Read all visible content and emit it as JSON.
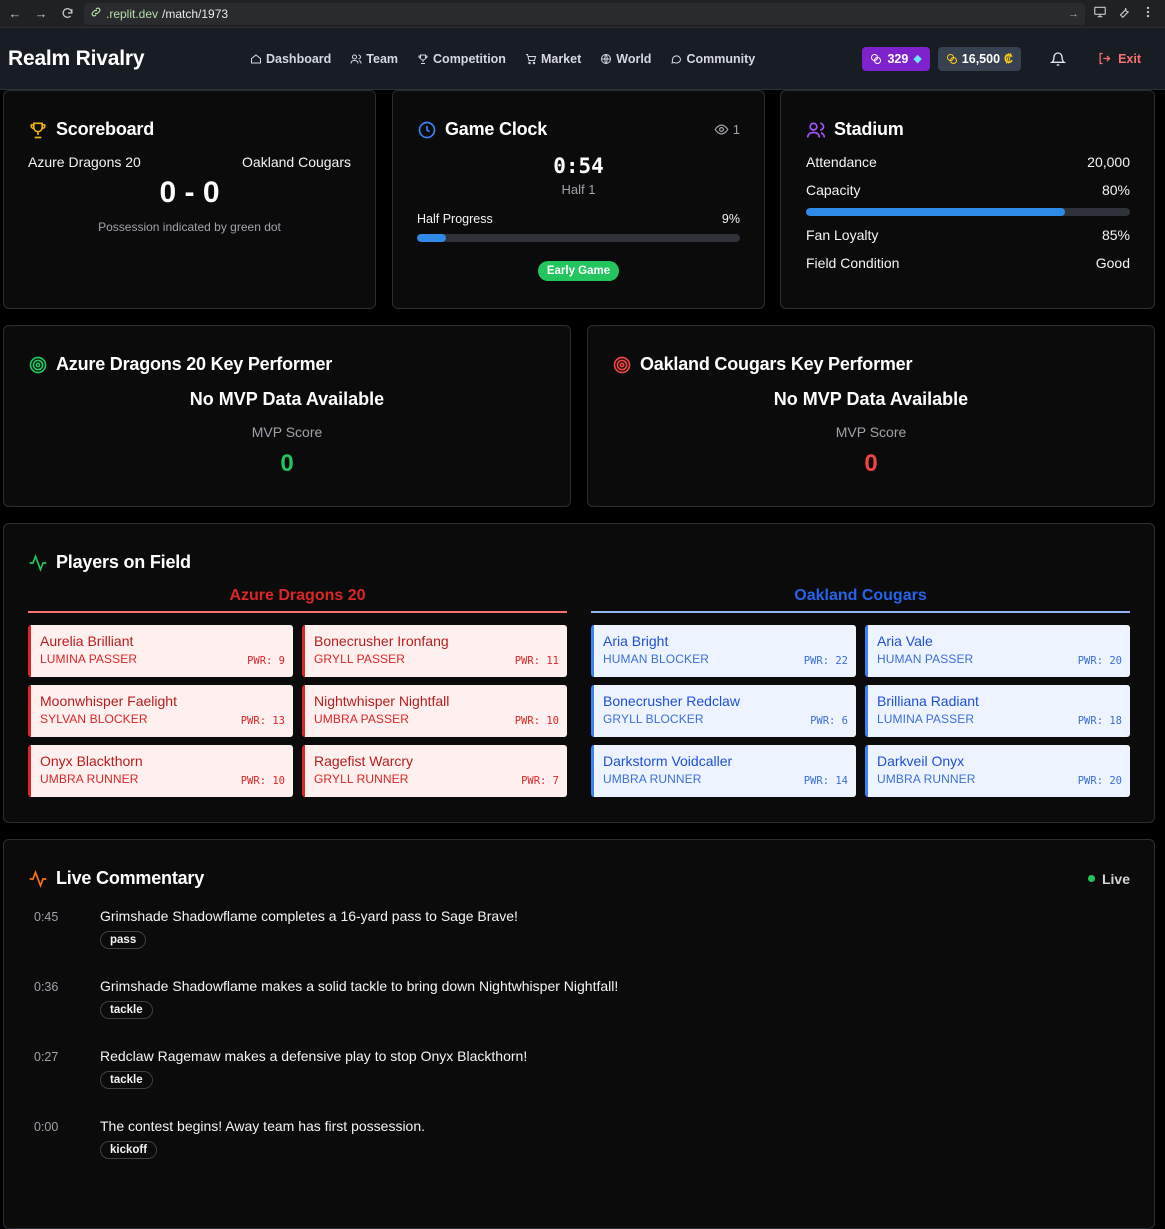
{
  "browser": {
    "url_domain": ".replit.dev",
    "url_path": "/match/1973"
  },
  "app": {
    "brand": "Realm Rivalry",
    "nav": [
      {
        "label": "Dashboard",
        "icon": "home-icon"
      },
      {
        "label": "Team",
        "icon": "users-icon"
      },
      {
        "label": "Competition",
        "icon": "trophy-icon"
      },
      {
        "label": "Market",
        "icon": "cart-icon"
      },
      {
        "label": "World",
        "icon": "globe-icon"
      },
      {
        "label": "Community",
        "icon": "chat-icon"
      }
    ],
    "gems": "329",
    "credits": "16,500",
    "credit_symbol": "₡",
    "exit_label": "Exit"
  },
  "scoreboard": {
    "title": "Scoreboard",
    "home_team": "Azure Dragons 20",
    "away_team": "Oakland Cougars",
    "score": "0 - 0",
    "note": "Possession indicated by green dot"
  },
  "game_clock": {
    "title": "Game Clock",
    "viewers": "1",
    "time": "0:54",
    "half": "Half 1",
    "progress_label": "Half Progress",
    "progress_text": "9%",
    "progress_fraction": 0.09,
    "phase_badge": "Early Game"
  },
  "stadium": {
    "title": "Stadium",
    "attendance_label": "Attendance",
    "attendance": "20,000",
    "capacity_label": "Capacity",
    "capacity": "80%",
    "capacity_fraction": 0.8,
    "loyalty_label": "Fan Loyalty",
    "loyalty": "85%",
    "field_label": "Field Condition",
    "field": "Good"
  },
  "key_performers": {
    "home": {
      "title": "Azure Dragons 20 Key Performer",
      "headline": "No MVP Data Available",
      "score_label": "MVP Score",
      "score": "0",
      "color": "#22c55e"
    },
    "away": {
      "title": "Oakland Cougars Key Performer",
      "headline": "No MVP Data Available",
      "score_label": "MVP Score",
      "score": "0",
      "color": "#ef4444"
    }
  },
  "players_on_field": {
    "title": "Players on Field",
    "home": {
      "team": "Azure Dragons 20",
      "players": [
        {
          "name": "Aurelia Brilliant",
          "role": "LUMINA PASSER",
          "pwr": "PWR: 9"
        },
        {
          "name": "Bonecrusher Ironfang",
          "role": "GRYLL PASSER",
          "pwr": "PWR: 11"
        },
        {
          "name": "Moonwhisper Faelight",
          "role": "SYLVAN BLOCKER",
          "pwr": "PWR: 13"
        },
        {
          "name": "Nightwhisper Nightfall",
          "role": "UMBRA PASSER",
          "pwr": "PWR: 10"
        },
        {
          "name": "Onyx Blackthorn",
          "role": "UMBRA RUNNER",
          "pwr": "PWR: 10"
        },
        {
          "name": "Ragefist Warcry",
          "role": "GRYLL RUNNER",
          "pwr": "PWR: 7"
        }
      ]
    },
    "away": {
      "team": "Oakland Cougars",
      "players": [
        {
          "name": "Aria Bright",
          "role": "HUMAN BLOCKER",
          "pwr": "PWR: 22"
        },
        {
          "name": "Aria Vale",
          "role": "HUMAN PASSER",
          "pwr": "PWR: 20"
        },
        {
          "name": "Bonecrusher Redclaw",
          "role": "GRYLL BLOCKER",
          "pwr": "PWR: 6"
        },
        {
          "name": "Brilliana Radiant",
          "role": "LUMINA PASSER",
          "pwr": "PWR: 18"
        },
        {
          "name": "Darkstorm Voidcaller",
          "role": "UMBRA RUNNER",
          "pwr": "PWR: 14"
        },
        {
          "name": "Darkveil Onyx",
          "role": "UMBRA RUNNER",
          "pwr": "PWR: 20"
        }
      ]
    }
  },
  "commentary": {
    "title": "Live Commentary",
    "live_label": "Live",
    "items": [
      {
        "time": "0:45",
        "text": "Grimshade Shadowflame completes a 16-yard pass to Sage Brave!",
        "tag": "pass"
      },
      {
        "time": "0:36",
        "text": "Grimshade Shadowflame makes a solid tackle to bring down Nightwhisper Nightfall!",
        "tag": "tackle"
      },
      {
        "time": "0:27",
        "text": "Redclaw Ragemaw makes a defensive play to stop Onyx Blackthorn!",
        "tag": "tackle"
      },
      {
        "time": "0:00",
        "text": "The contest begins! Away team has first possession.",
        "tag": "kickoff"
      }
    ]
  }
}
